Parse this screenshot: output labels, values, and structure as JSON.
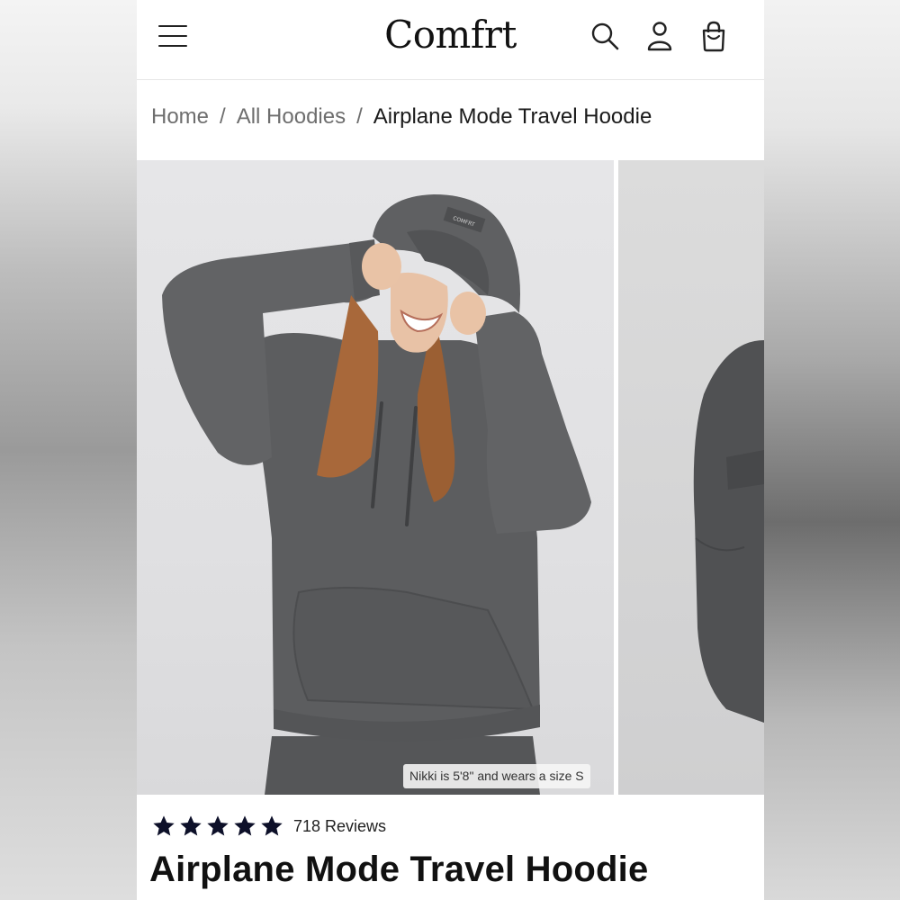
{
  "header": {
    "brand": "Comfrt",
    "menu_icon": "hamburger-menu-icon",
    "search_icon": "search-icon",
    "account_icon": "user-account-icon",
    "cart_icon": "shopping-bag-icon"
  },
  "breadcrumb": {
    "items": [
      "Home",
      "All Hoodies"
    ],
    "separator": "/",
    "current": "Airplane Mode Travel Hoodie"
  },
  "gallery": {
    "model_caption": "Nikki is 5'8\" and wears a size S",
    "hoodie_tag": "COMFRT"
  },
  "reviews": {
    "rating": 5,
    "star_icon": "star-icon",
    "count_label": "718 Reviews"
  },
  "product": {
    "title": "Airplane Mode Travel Hoodie"
  },
  "colors": {
    "star": "#0d1029",
    "text": "#111111",
    "muted": "#6e6e6e",
    "hoodie": "#5a5b5d"
  }
}
